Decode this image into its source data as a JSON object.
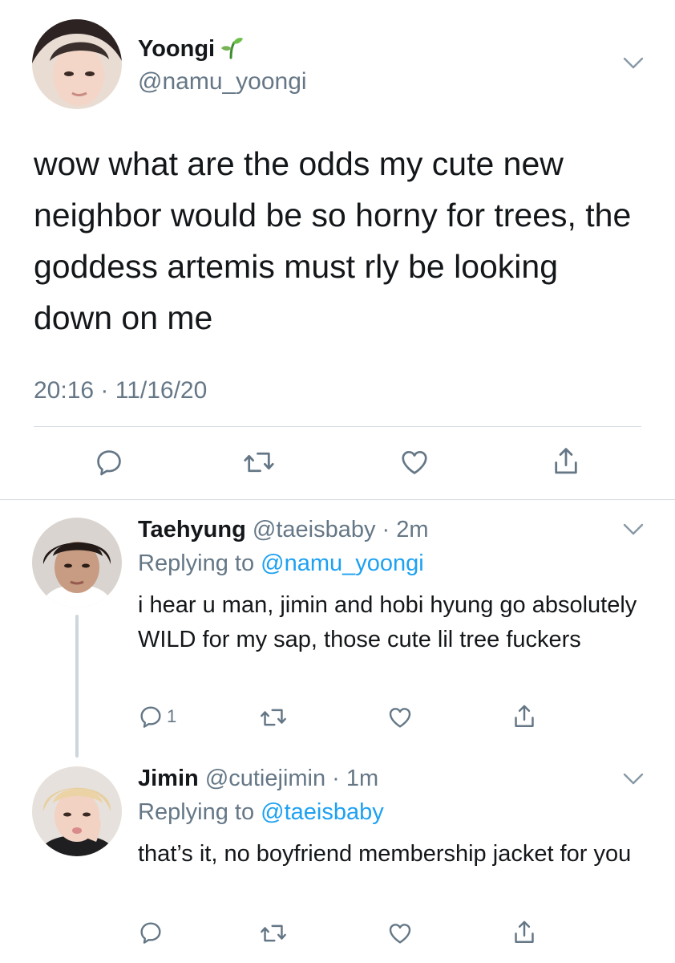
{
  "main_tweet": {
    "display_name": "Yoongi",
    "name_emoji": "seedling-icon",
    "handle": "@namu_yoongi",
    "text": "wow what are the odds my cute new neighbor would be so horny for trees, the goddess artemis must rly be looking down on me",
    "timestamp": "20:16 · 11/16/20",
    "actions": [
      "reply-icon",
      "retweet-icon",
      "like-icon",
      "share-icon"
    ]
  },
  "replies": [
    {
      "display_name": "Taehyung",
      "handle": "@taeisbaby",
      "separator": " · ",
      "time": "2m",
      "replying_prefix": "Replying to ",
      "replying_to": "@namu_yoongi",
      "text": "i hear u man, jimin and hobi hyung go absolutely WILD for my sap, those cute lil tree fuckers",
      "reply_count": "1"
    },
    {
      "display_name": "Jimin",
      "handle": "@cutiejimin",
      "separator": " · ",
      "time": "1m",
      "replying_prefix": "Replying to ",
      "replying_to": "@taeisbaby",
      "text": "that’s it, no boyfriend membership jacket for you",
      "reply_count": ""
    }
  ],
  "colors": {
    "text": "#14171a",
    "secondary": "#657786",
    "link": "#1da1f2",
    "divider": "#d8dee3",
    "thread_line": "#ccd6dd",
    "icon": "#657786"
  }
}
